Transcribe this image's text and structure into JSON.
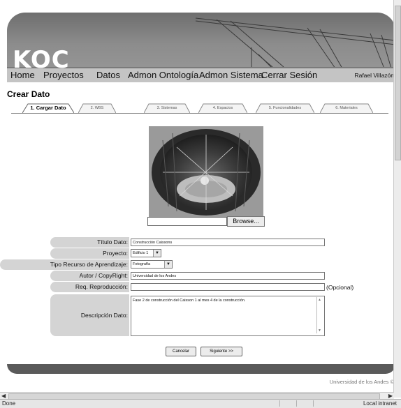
{
  "nav": {
    "logo": "KOC",
    "items": [
      "Home",
      "Proyectos",
      "Datos",
      "Admon Ontología",
      "Admon Sistema",
      "Cerrar Sesión"
    ],
    "user": "Rafael Villazón"
  },
  "page_title": "Crear Dato",
  "tabs": [
    "1. Cargar Dato",
    "2. WBS",
    "3. Sistemas",
    "4. Espacios",
    "5. Funcionalidades",
    "6. Materiales"
  ],
  "upload": {
    "browse_label": "Browse..."
  },
  "form": {
    "titulo_label": "Título Dato:",
    "titulo_value": "Construcción Caissons",
    "proyecto_label": "Proyecto:",
    "proyecto_value": "Edificio 1",
    "tipo_label": "Tipo Recurso de Aprendizaje:",
    "tipo_value": "Fotografía",
    "autor_label": "Autor / CopyRight:",
    "autor_value": "Universidad de los Andes",
    "req_label": "Req. Reproducción:",
    "req_value": "",
    "opcional": "(Opcional)",
    "descripcion_label": "Descripción Dato:",
    "descripcion_value": "Fase 2 de construcción del Caisson 1 al mes 4 de la construcción."
  },
  "buttons": {
    "cancel": "Cancelar",
    "next": "Siguiente >>"
  },
  "footer": "Universidad de los Andes ©",
  "status": {
    "done": "Done",
    "zone": "Local intranet"
  }
}
